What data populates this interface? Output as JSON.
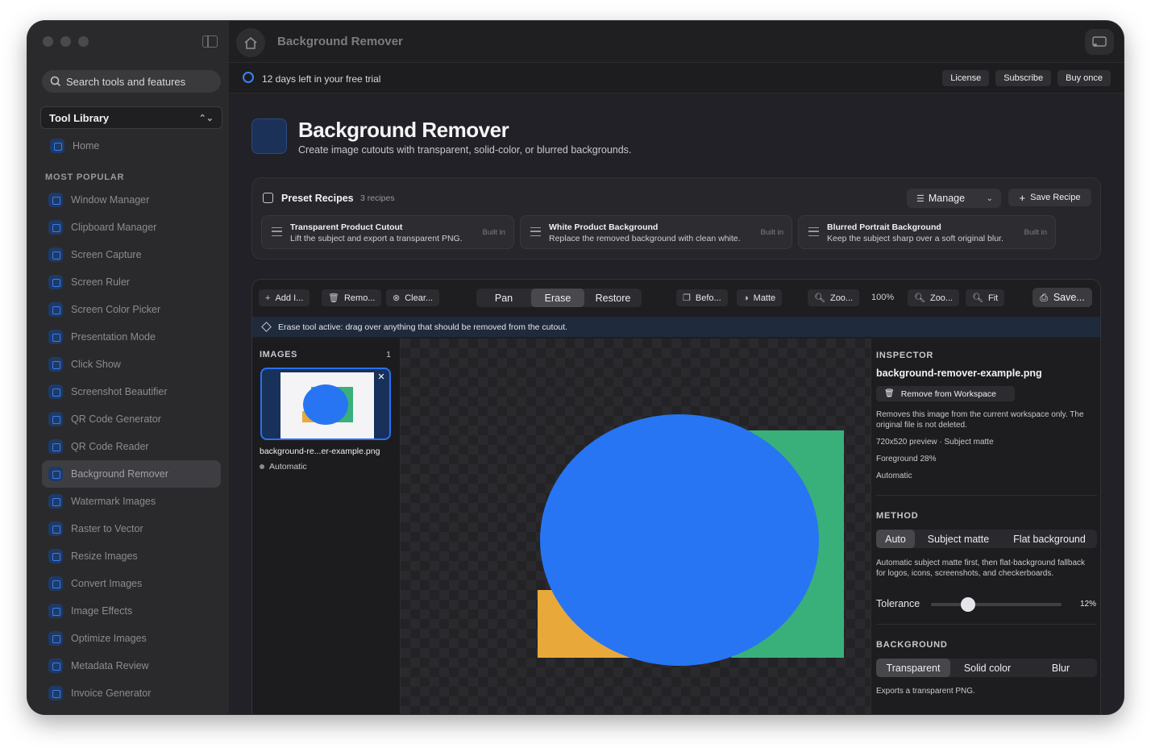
{
  "sidebar": {
    "search_placeholder": "Search tools and features",
    "library_select": "Tool Library",
    "home_label": "Home",
    "section_title": "MOST POPULAR",
    "items": [
      {
        "label": "Window Manager",
        "icon": "window-manager-icon"
      },
      {
        "label": "Clipboard Manager",
        "icon": "clipboard-icon"
      },
      {
        "label": "Screen Capture",
        "icon": "screen-capture-icon"
      },
      {
        "label": "Screen Ruler",
        "icon": "ruler-icon"
      },
      {
        "label": "Screen Color Picker",
        "icon": "color-picker-icon"
      },
      {
        "label": "Presentation Mode",
        "icon": "presentation-icon"
      },
      {
        "label": "Click Show",
        "icon": "click-icon"
      },
      {
        "label": "Screenshot Beautifier",
        "icon": "beautifier-icon"
      },
      {
        "label": "QR Code Generator",
        "icon": "qr-code-icon"
      },
      {
        "label": "QR Code Reader",
        "icon": "qr-reader-icon"
      },
      {
        "label": "Background Remover",
        "icon": "background-remover-icon",
        "active": true
      },
      {
        "label": "Watermark Images",
        "icon": "watermark-icon"
      },
      {
        "label": "Raster to Vector",
        "icon": "vector-icon"
      },
      {
        "label": "Resize Images",
        "icon": "resize-icon"
      },
      {
        "label": "Convert Images",
        "icon": "convert-icon"
      },
      {
        "label": "Image Effects",
        "icon": "effects-icon"
      },
      {
        "label": "Optimize Images",
        "icon": "optimize-icon"
      },
      {
        "label": "Metadata Review",
        "icon": "metadata-icon"
      },
      {
        "label": "Invoice Generator",
        "icon": "invoice-icon"
      }
    ]
  },
  "topbar": {
    "title": "Background Remover"
  },
  "trial": {
    "text": "12 days left in your free trial",
    "license": "License",
    "subscribe": "Subscribe",
    "buy_once": "Buy once"
  },
  "hero": {
    "title": "Background Remover",
    "subtitle": "Create image cutouts with transparent, solid-color, or blurred backgrounds."
  },
  "recipes": {
    "title": "Preset Recipes",
    "count": "3 recipes",
    "manage": "Manage",
    "save_recipe": "Save Recipe",
    "cards": [
      {
        "name": "Transparent Product Cutout",
        "desc": "Lift the subject and export a transparent PNG.",
        "badge": "Built in"
      },
      {
        "name": "White Product Background",
        "desc": "Replace the removed background with clean white.",
        "badge": "Built in"
      },
      {
        "name": "Blurred Portrait Background",
        "desc": "Keep the subject sharp over a soft original blur.",
        "badge": "Built in"
      }
    ]
  },
  "toolbar": {
    "add": "Add I...",
    "remove": "Remo...",
    "clear": "Clear...",
    "modes": [
      "Pan",
      "Erase",
      "Restore"
    ],
    "active_mode": "Erase",
    "before": "Befo...",
    "matte": "Matte",
    "zoom_out": "Zoo...",
    "zoom_level": "100%",
    "zoom_in": "Zoo...",
    "fit": "Fit",
    "save": "Save..."
  },
  "banner": {
    "text": "Erase tool active: drag over anything that should be removed from the cutout."
  },
  "images": {
    "title": "IMAGES",
    "count": "1",
    "file": "background-re...er-example.png",
    "status": "Automatic"
  },
  "inspector": {
    "title": "INSPECTOR",
    "filename": "background-remover-example.png",
    "remove_button": "Remove from Workspace",
    "remove_note": "Removes this image from the current workspace only. The original file is not deleted.",
    "preview_info": "720x520 preview · Subject matte",
    "foreground": "Foreground 28%",
    "mode": "Automatic",
    "method_title": "METHOD",
    "methods": [
      "Auto",
      "Subject matte",
      "Flat background"
    ],
    "active_method": "Auto",
    "method_note": "Automatic subject matte first, then flat-background fallback for logos, icons, screenshots, and checkerboards.",
    "tolerance_label": "Tolerance",
    "tolerance_value": "12%",
    "tolerance_fraction": 0.12,
    "background_title": "BACKGROUND",
    "backgrounds": [
      "Transparent",
      "Solid color",
      "Blur"
    ],
    "active_background": "Transparent",
    "background_note": "Exports a transparent PNG."
  },
  "colors": {
    "accent": "#2d6ff0",
    "shape_blue": "#2775f2",
    "shape_green": "#39b07a",
    "shape_orange": "#e9a93a"
  }
}
